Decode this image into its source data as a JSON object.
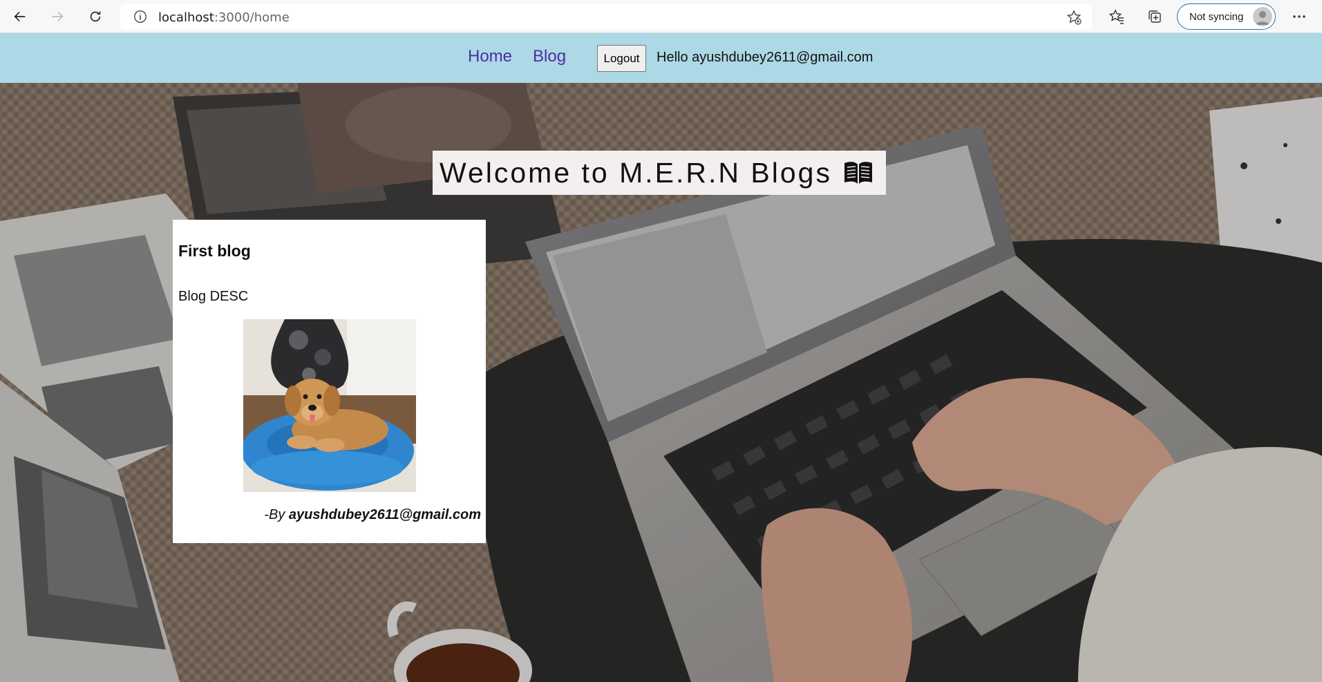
{
  "browser": {
    "url_host": "localhost",
    "url_path": ":3000/home",
    "sync_label": "Not syncing",
    "icons": [
      "back-icon",
      "forward-icon",
      "refresh-icon",
      "site-info-icon",
      "add-favorite-icon",
      "favorites-icon",
      "collections-icon",
      "profile-avatar-icon",
      "more-icon"
    ]
  },
  "nav": {
    "home_label": "Home",
    "blog_label": "Blog",
    "logout_label": "Logout",
    "greeting": "Hello ayushdubey2611@gmail.com",
    "link_color": "#4b2ea0",
    "background_color": "#add8e6"
  },
  "hero": {
    "heading": "Welcome to M.E.R.N Blogs",
    "heading_icon": "open-book-icon"
  },
  "blogs": [
    {
      "title": "First blog",
      "description": "Blog DESC",
      "author_prefix": "-By",
      "author": "ayushdubey2611@gmail.com",
      "image": "dog-in-blue-bed-photo"
    }
  ]
}
